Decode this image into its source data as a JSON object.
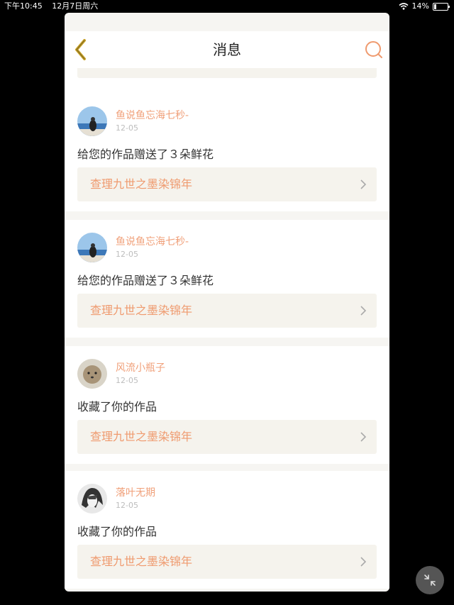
{
  "status_bar": {
    "time": "下午10:45",
    "date": "12月7日周六",
    "battery": "14%"
  },
  "header": {
    "title": "消息"
  },
  "messages": [
    {
      "username": "鱼说鱼忘海七秒-",
      "date": "12-05",
      "text": "给您的作品赠送了３朵鲜花",
      "work_title": "查理九世之墨染锦年"
    },
    {
      "username": "鱼说鱼忘海七秒-",
      "date": "12-05",
      "text": "给您的作品赠送了３朵鲜花",
      "work_title": "查理九世之墨染锦年"
    },
    {
      "username": "风流小瓶子",
      "date": "12-05",
      "text": "收藏了你的作品",
      "work_title": "查理九世之墨染锦年"
    },
    {
      "username": "落叶无期",
      "date": "12-05",
      "text": "收藏了你的作品",
      "work_title": "查理九世之墨染锦年"
    }
  ],
  "icons": {
    "back": "chevron-left-icon",
    "search": "search-icon",
    "link_arrow": "chevron-right-icon",
    "collapse": "collapse-arrows-icon"
  },
  "colors": {
    "accent": "#ef9a6e",
    "back_arrow": "#c9a227",
    "card_bg": "#ffffff",
    "page_bg": "#f6f5f2",
    "link_bg": "#f5f3ed"
  }
}
